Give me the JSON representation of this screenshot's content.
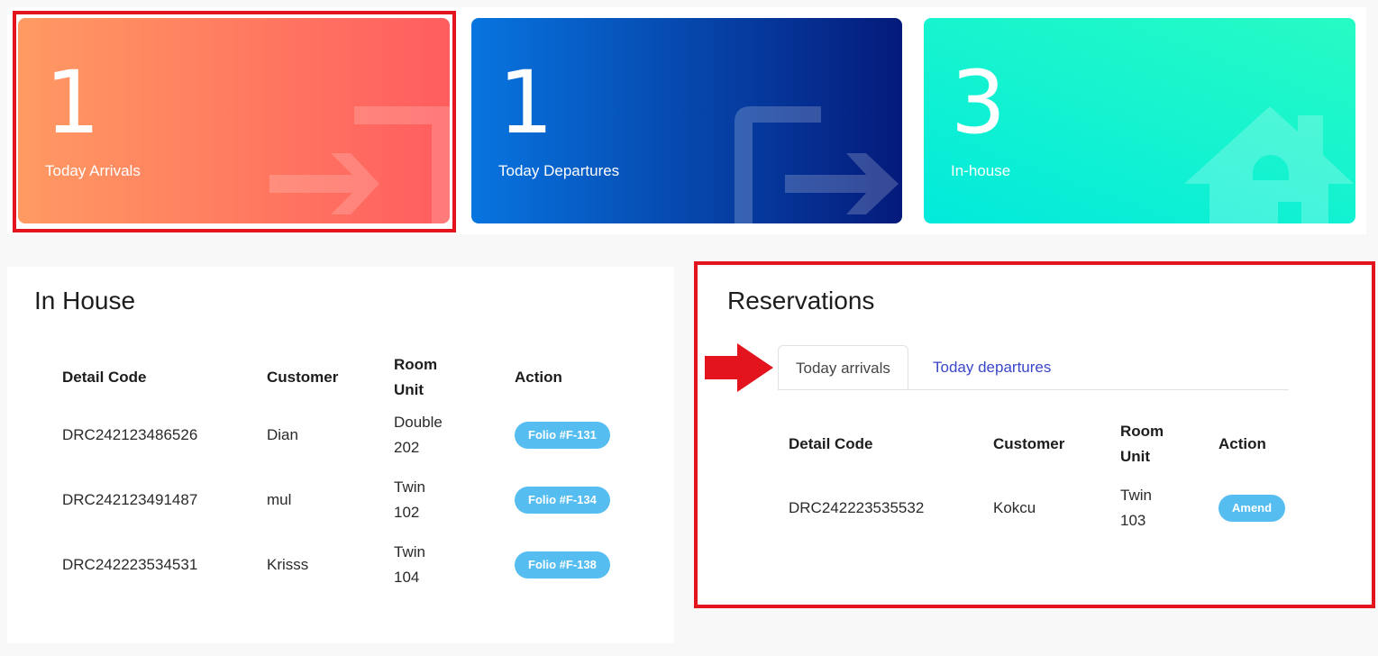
{
  "stats": [
    {
      "value": "1",
      "label": "Today Arrivals"
    },
    {
      "value": "1",
      "label": "Today Departures"
    },
    {
      "value": "3",
      "label": "In-house"
    }
  ],
  "in_house": {
    "title": "In House",
    "columns": [
      "Detail Code",
      "Customer",
      "Room Unit",
      "Action"
    ],
    "rows": [
      {
        "code": "DRC242123486526",
        "customer": "Dian",
        "room_type": "Double",
        "room_no": "202",
        "action": "Folio #F-131"
      },
      {
        "code": "DRC242123491487",
        "customer": "mul",
        "room_type": "Twin",
        "room_no": "102",
        "action": "Folio #F-134"
      },
      {
        "code": "DRC242223534531",
        "customer": "Krisss",
        "room_type": "Twin",
        "room_no": "104",
        "action": "Folio #F-138"
      }
    ]
  },
  "reservations": {
    "title": "Reservations",
    "tabs": [
      "Today arrivals",
      "Today departures"
    ],
    "columns": [
      "Detail Code",
      "Customer",
      "Room Unit",
      "Action"
    ],
    "rows": [
      {
        "code": "DRC242223535532",
        "customer": "Kokcu",
        "room_type": "Twin",
        "room_no": "103",
        "action": "Amend"
      }
    ]
  },
  "colors": {
    "arrivals_gradient": [
      "#ff9a62",
      "#ff5d5f"
    ],
    "departures_gradient": [
      "#0875e0",
      "#041a7a"
    ],
    "inhouse_gradient": [
      "#27fbc4",
      "#02eadc"
    ],
    "pill": "#55bdf0",
    "highlight": "#e3141d",
    "link": "#3a47c9"
  }
}
